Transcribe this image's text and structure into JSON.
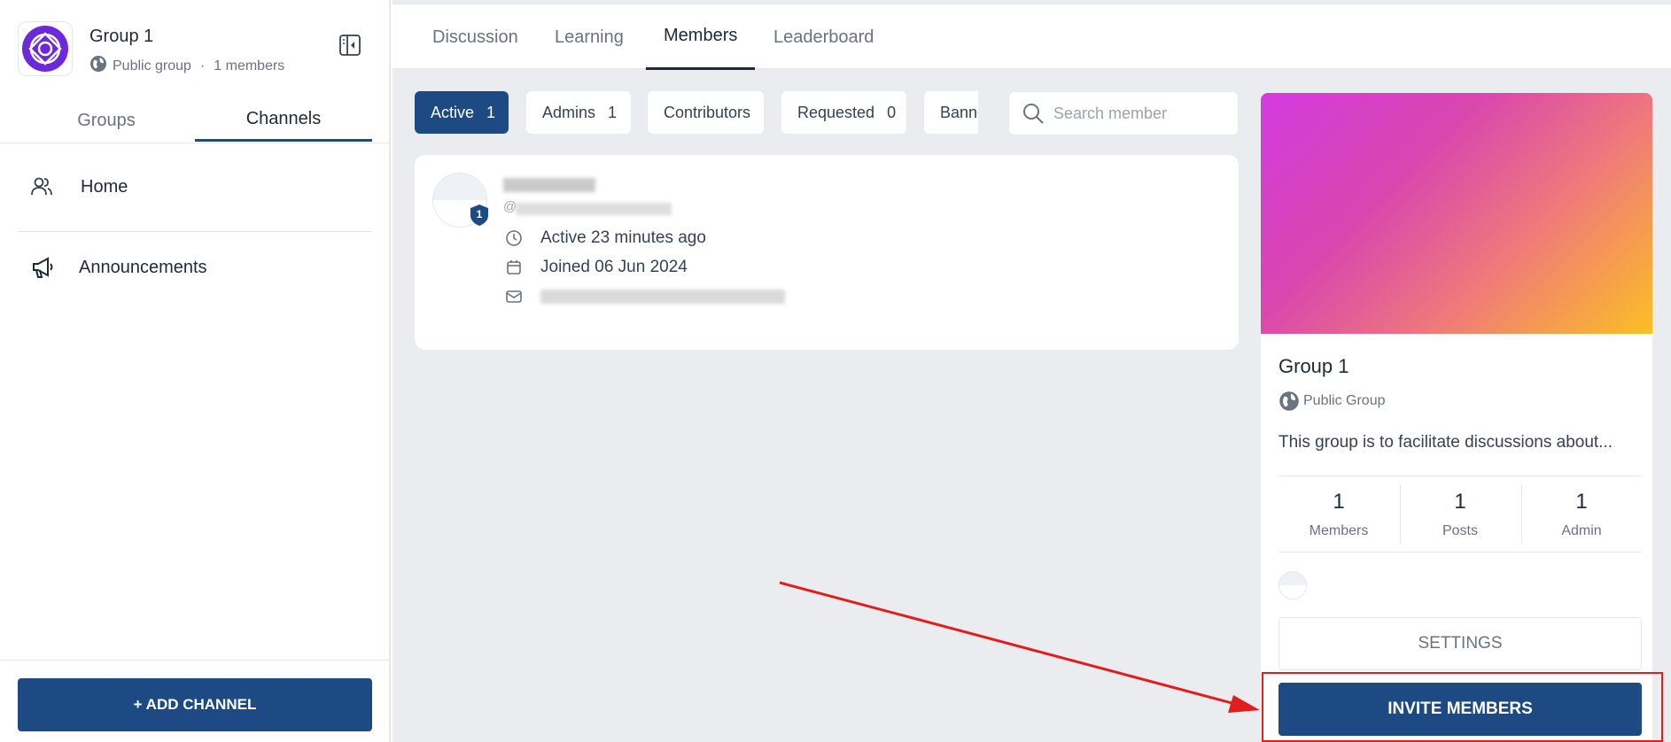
{
  "sidebar": {
    "group_name": "Group 1",
    "group_type": "Public group",
    "separator": "·",
    "member_count": "1 members",
    "tabs": [
      {
        "label": "Groups",
        "active": false
      },
      {
        "label": "Channels",
        "active": true
      }
    ],
    "items": [
      {
        "label": "Home",
        "icon": "users-icon"
      },
      {
        "label": "Announcements",
        "icon": "megaphone-icon"
      }
    ],
    "add_channel_label": "+ ADD CHANNEL"
  },
  "topnav": {
    "tabs": [
      {
        "label": "Discussion",
        "active": false
      },
      {
        "label": "Learning",
        "active": false
      },
      {
        "label": "Members",
        "active": true
      },
      {
        "label": "Leaderboard",
        "active": false
      }
    ]
  },
  "filters": {
    "chips": [
      {
        "label": "Active",
        "count": "1",
        "active": true
      },
      {
        "label": "Admins",
        "count": "1",
        "active": false
      },
      {
        "label": "Contributors",
        "count": "",
        "active": false
      },
      {
        "label": "Requested",
        "count": "0",
        "active": false
      },
      {
        "label": "Banned",
        "count": "",
        "active": false
      }
    ],
    "search_placeholder": "Search member"
  },
  "member": {
    "badge": "1",
    "handle_prefix": "@",
    "active": "Active 23 minutes ago",
    "joined": "Joined 06 Jun 2024"
  },
  "panel": {
    "title": "Group 1",
    "type": "Public Group",
    "description": "This group is to facilitate discussions about...",
    "stats": [
      {
        "value": "1",
        "label": "Members"
      },
      {
        "value": "1",
        "label": "Posts"
      },
      {
        "value": "1",
        "label": "Admin"
      }
    ],
    "settings_label": "SETTINGS",
    "invite_label": "INVITE MEMBERS"
  },
  "colors": {
    "primary": "#1d4a82",
    "annotation": "#e11d1d",
    "cover_gradient": [
      "#d43be0",
      "#ef7a7a",
      "#fbbf24"
    ]
  }
}
